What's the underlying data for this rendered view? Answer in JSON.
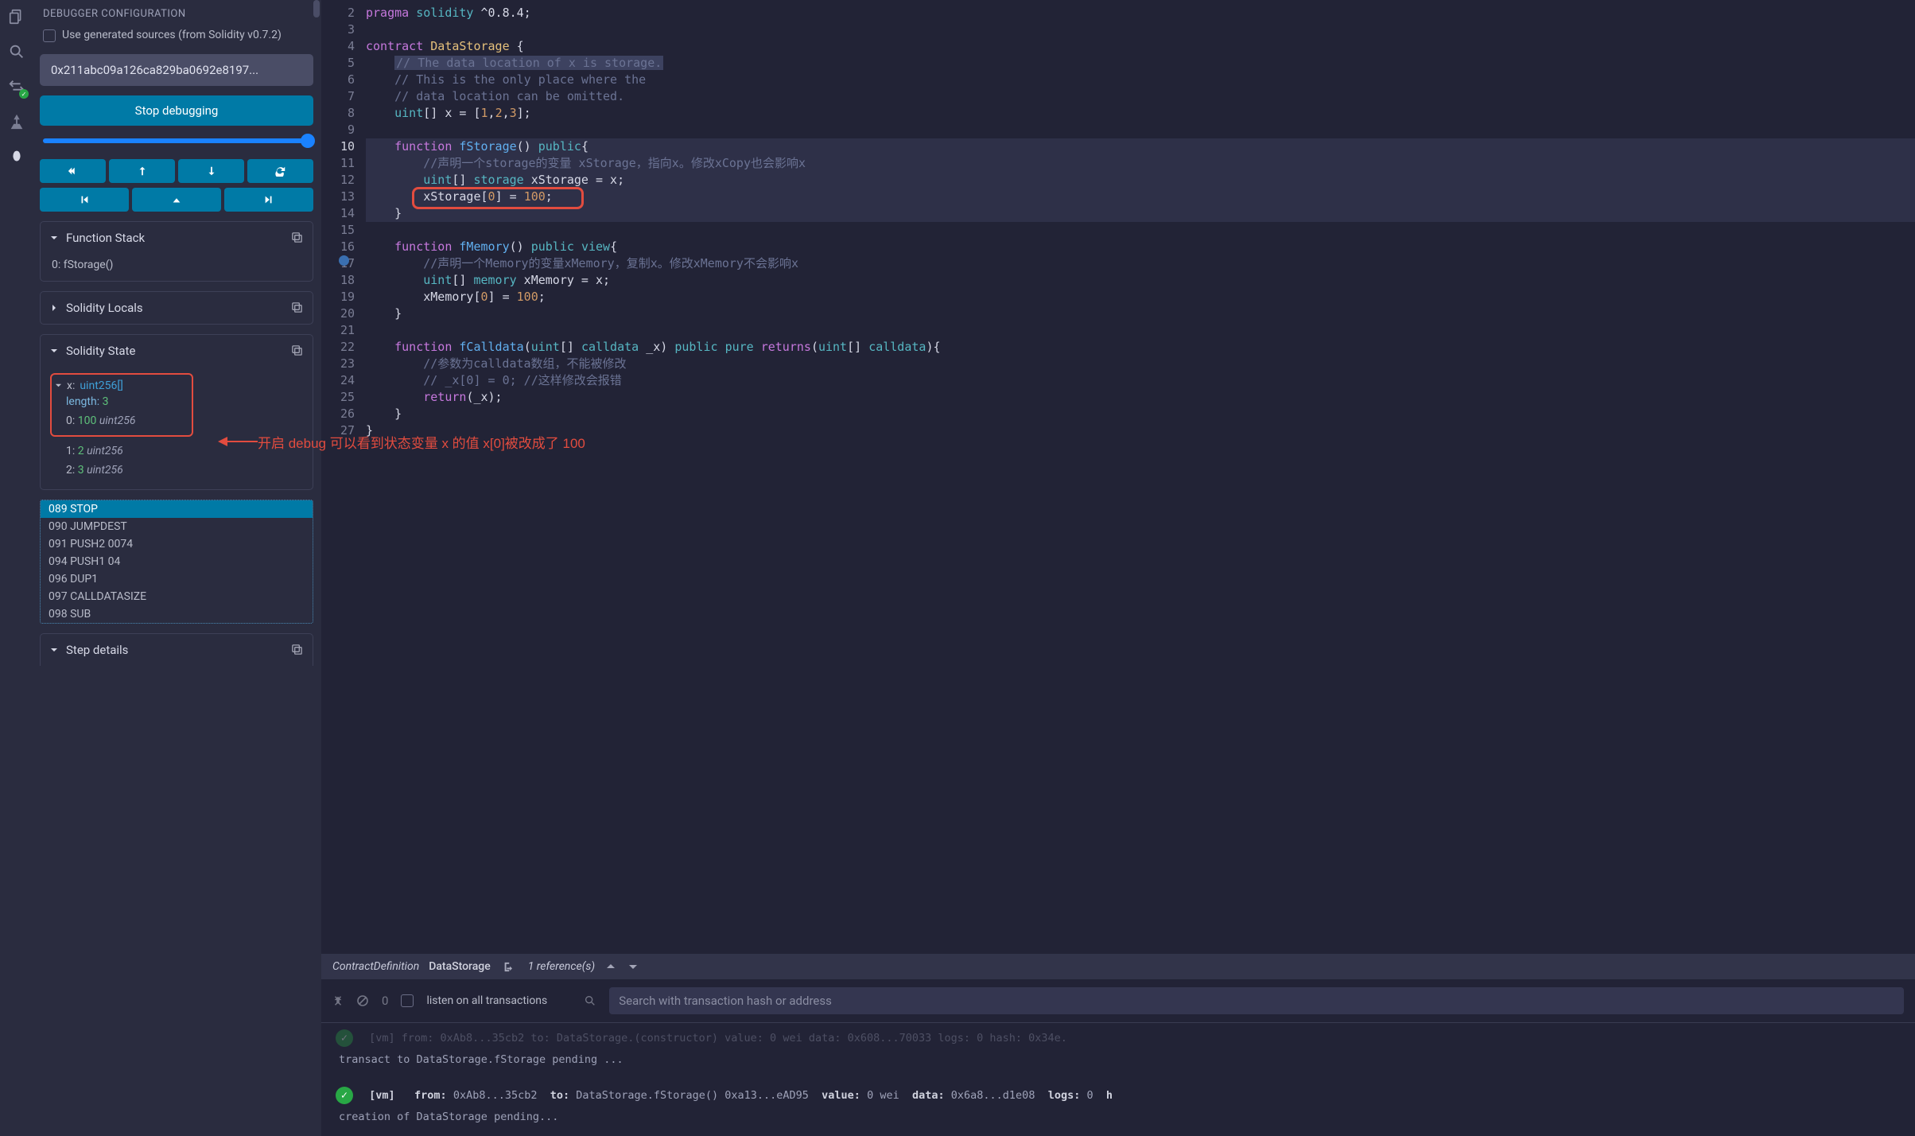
{
  "iconbar": {
    "icons": [
      "files-icon",
      "search-icon",
      "swap-icon",
      "deploy-icon",
      "debugger-icon"
    ]
  },
  "debugger": {
    "config_title": "DEBUGGER CONFIGURATION",
    "use_generated_label": "Use generated sources (from Solidity v0.7.2)",
    "tx_hash": "0x211abc09a126ca829ba0692e8197...",
    "stop_label": "Stop debugging",
    "panels": {
      "function_stack": {
        "title": "Function Stack",
        "item": "0: fStorage()"
      },
      "solidity_locals": {
        "title": "Solidity Locals"
      },
      "solidity_state": {
        "title": "Solidity State",
        "var_name": "x:",
        "var_type": "uint256[]",
        "length_label": "length:",
        "length_val": "3",
        "items": [
          {
            "idx": "0:",
            "val": "100",
            "type": "uint256"
          },
          {
            "idx": "1:",
            "val": "2",
            "type": "uint256"
          },
          {
            "idx": "2:",
            "val": "3",
            "type": "uint256"
          }
        ]
      },
      "step_details": {
        "title": "Step details"
      }
    },
    "opcodes": [
      "089 STOP",
      "090 JUMPDEST",
      "091 PUSH2 0074",
      "094 PUSH1 04",
      "096 DUP1",
      "097 CALLDATASIZE",
      "098 SUB"
    ]
  },
  "editor": {
    "lines": [
      {
        "n": 2,
        "html": "<span class='kw-purple'>pragma</span> <span class='kw-blue'>solidity</span> ^0.8.4;"
      },
      {
        "n": 3,
        "html": ""
      },
      {
        "n": 4,
        "html": "<span class='kw-purple'>contract</span> <span class='type'>DataStorage</span> {"
      },
      {
        "n": 5,
        "html": "    <span class='cmt' style='background:#3d4260;padding:0 2px;'>// The data location of x is storage.</span>"
      },
      {
        "n": 6,
        "html": "    <span class='cmt'>// This is the only place where the</span>"
      },
      {
        "n": 7,
        "html": "    <span class='cmt'>// data location can be omitted.</span>"
      },
      {
        "n": 8,
        "html": "    <span class='kw-blue'>uint</span>[] x = [<span class='num'>1</span>,<span class='num'>2</span>,<span class='num'>3</span>];"
      },
      {
        "n": 9,
        "html": ""
      },
      {
        "n": 10,
        "html": "    <span class='kw-purple'>function</span> <span class='fn'>fStorage</span>() <span class='kw-blue'>public</span>{",
        "hl": true,
        "cur": true
      },
      {
        "n": 11,
        "html": "        <span class='cmt'>//声明一个storage的变量 xStorage，指向x。修改xCopy也会影响x</span>",
        "hl": true
      },
      {
        "n": 12,
        "html": "        <span class='kw-blue'>uint</span>[] <span class='kw-blue'>storage</span> xStorage = x;",
        "hl": true
      },
      {
        "n": 13,
        "html": "        xStorage[<span class='num'>0</span>] = <span class='num'>100</span>;",
        "hl": true
      },
      {
        "n": 14,
        "html": "    }",
        "hl": true
      },
      {
        "n": 15,
        "html": ""
      },
      {
        "n": 16,
        "html": "    <span class='kw-purple'>function</span> <span class='fn'>fMemory</span>() <span class='kw-blue'>public</span> <span class='kw-blue'>view</span>{",
        "bp": true
      },
      {
        "n": 17,
        "html": "        <span class='cmt'>//声明一个Memory的变量xMemory，复制x。修改xMemory不会影响x</span>"
      },
      {
        "n": 18,
        "html": "        <span class='kw-blue'>uint</span>[] <span class='kw-blue'>memory</span> xMemory = x;"
      },
      {
        "n": 19,
        "html": "        xMemory[<span class='num'>0</span>] = <span class='num'>100</span>;"
      },
      {
        "n": 20,
        "html": "    }"
      },
      {
        "n": 21,
        "html": ""
      },
      {
        "n": 22,
        "html": "    <span class='kw-purple'>function</span> <span class='fn'>fCalldata</span>(<span class='kw-blue'>uint</span>[] <span class='kw-blue'>calldata</span> _x) <span class='kw-blue'>public</span> <span class='kw-blue'>pure</span> <span class='kw-purple'>returns</span>(<span class='kw-blue'>uint</span>[] <span class='kw-blue'>calldata</span>){"
      },
      {
        "n": 23,
        "html": "        <span class='cmt'>//参数为calldata数组，不能被修改</span>"
      },
      {
        "n": 24,
        "html": "        <span class='cmt'>// _x[0] = 0; //这样修改会报错</span>"
      },
      {
        "n": 25,
        "html": "        <span class='kw-purple'>return</span>(_x);"
      },
      {
        "n": 26,
        "html": "    }"
      },
      {
        "n": 27,
        "html": "}"
      }
    ]
  },
  "refbar": {
    "breadcrumb_kind": "ContractDefinition",
    "breadcrumb_name": "DataStorage",
    "ref_count": "1 reference(s)"
  },
  "console": {
    "listen_label": "listen on all transactions",
    "search_placeholder": "Search with transaction hash or address",
    "count": "0",
    "log1_faded": "[vm]  from: 0xAb8...35cb2 to: DataStorage.(constructor) value: 0 wei data: 0x608...70033 logs: 0 hash: 0x34e.",
    "log1_line2": "transact to DataStorage.fStorage pending ...",
    "log2_prefix": "[vm]",
    "log2_from_l": "from:",
    "log2_from_v": "0xAb8...35cb2",
    "log2_to_l": "to:",
    "log2_to_v": "DataStorage.fStorage() 0xa13...eAD95",
    "log2_value_l": "value:",
    "log2_value_v": "0 wei",
    "log2_data_l": "data:",
    "log2_data_v": "0x6a8...d1e08",
    "log2_logs_l": "logs:",
    "log2_logs_v": "0",
    "log2_hash_l": "h",
    "log3": "creation of DataStorage pending..."
  },
  "annotation": {
    "text": "开启 debug 可以看到状态变量 x 的值 x[0]被改成了 100"
  }
}
